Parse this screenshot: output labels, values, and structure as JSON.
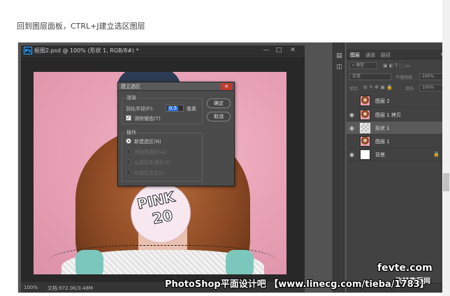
{
  "caption": "回到图层面板，CTRL+J建立选区图层",
  "document": {
    "badge": "Ps",
    "title": "抠图2.psd @ 100% (形状 1, RGB/8#) *",
    "controls": [
      "—",
      "□",
      "✕"
    ],
    "status_zoom": "100%",
    "status_doc": "文档:972.0K/3.48M"
  },
  "photo": {
    "bubble_line1": "PINK",
    "bubble_line2": "20"
  },
  "dialog": {
    "title": "建立选区",
    "close": "✕",
    "render_group": "渲染",
    "feather_label": "羽化半径(F):",
    "feather_value": "0.5",
    "feather_unit": "像素",
    "antialias_label": "消除锯齿(T)",
    "antialias_checked": true,
    "operation_group": "操作",
    "operations": [
      {
        "label": "新建选区(N)",
        "selected": true,
        "enabled": true
      },
      {
        "label": "添加到选区(A)",
        "selected": false,
        "enabled": false
      },
      {
        "label": "从选区中减去(S)",
        "selected": false,
        "enabled": false
      },
      {
        "label": "与选区交叉(I)",
        "selected": false,
        "enabled": false
      }
    ],
    "ok_label": "确定",
    "cancel_label": "取消"
  },
  "dock_icons": [
    "history-icon",
    "properties-icon"
  ],
  "layers_panel": {
    "tabs": [
      "图层",
      "通道",
      "路径"
    ],
    "active_tab": "图层",
    "menu": "≡",
    "filter_label": "类型",
    "blend_mode": "正常",
    "opacity_label": "不透明度:",
    "opacity_value": "100%",
    "lock_label": "锁定:",
    "fill_label": "填充:",
    "fill_value": "100%",
    "layers": [
      {
        "name": "图层 2",
        "visible": false,
        "thumb": "photo",
        "selected": false,
        "locked": false
      },
      {
        "name": "图层 1 拷贝",
        "visible": true,
        "thumb": "photo",
        "selected": false,
        "locked": false
      },
      {
        "name": "形状 1",
        "visible": true,
        "thumb": "shape",
        "selected": true,
        "locked": false
      },
      {
        "name": "图层 1",
        "visible": false,
        "thumb": "photo",
        "selected": false,
        "locked": false
      },
      {
        "name": "背景",
        "visible": true,
        "thumb": "white",
        "selected": false,
        "locked": true
      }
    ]
  },
  "watermark": "PhotoShop平面设计吧 【www.linecg.com/tieba/1783】",
  "logo_line1": "fevte.com",
  "logo_line2": "飞特教程网"
}
